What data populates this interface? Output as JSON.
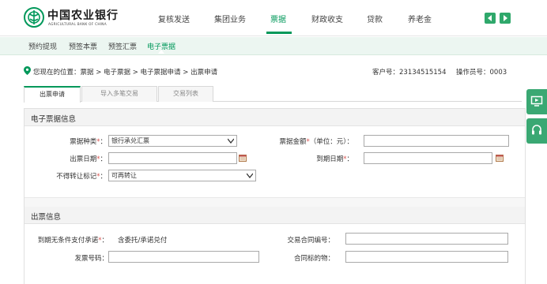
{
  "header": {
    "logo_cn": "中国农业银行",
    "logo_en": "AGRICULTURAL BANK OF CHINA",
    "nav": [
      "复核发送",
      "集团业务",
      "票据",
      "财政收支",
      "贷款",
      "养老金"
    ],
    "active_nav": "票据",
    "accent_color": "#01985a"
  },
  "subnav": {
    "items": [
      "预约提现",
      "预签本票",
      "预签汇票",
      "电子票据"
    ],
    "active": "电子票据"
  },
  "breadcrumb": {
    "text": "您现在的位置：票据 > 电子票据 > 电子票据申请 > 出票申请",
    "customer_no": "客户号：23134515154",
    "operator_no": "操作员号：0003"
  },
  "tabs": [
    "出票申请",
    "导入多笔交易",
    "交易列表"
  ],
  "section1": {
    "title": "电子票据信息",
    "bill_type_label": "票据种类",
    "bill_type_value": "银行承兑汇票",
    "amount_label": "票据金额",
    "amount_unit": "（单位：元）：",
    "issue_date_label": "出票日期",
    "due_date_label": "到期日期",
    "no_transfer_label": "不得转让标记",
    "no_transfer_value": "可再转让",
    "required_mark": "*",
    "colon": "："
  },
  "section2": {
    "title": "出票信息",
    "promise_label": "到期无条件支付承诺",
    "promise_value": "含委托/承诺兑付",
    "contract_no_label": "交易合同编号：",
    "invoice_no_label": "发票号码：",
    "contract_target_label": "合同标的物："
  },
  "icons": {
    "logo": "abc-logo-icon",
    "location": "location-pin-icon",
    "calendar": "calendar-icon",
    "prev": "chevron-left-icon",
    "next": "chevron-right-icon",
    "screen": "screen-icon",
    "headset": "headset-icon"
  }
}
